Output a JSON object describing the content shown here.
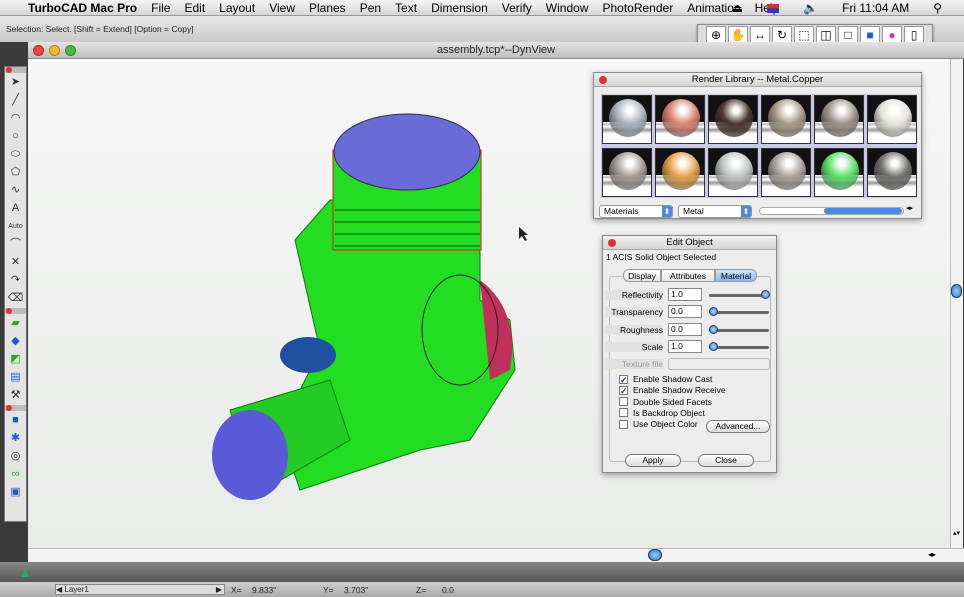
{
  "menubar": {
    "app": "TurboCAD Mac Pro",
    "items": [
      "File",
      "Edit",
      "Layout",
      "View",
      "Planes",
      "Pen",
      "Text",
      "Dimension",
      "Verify",
      "Window",
      "PhotoRender",
      "Animation",
      "Help"
    ],
    "clock": "Fri 11:04 AM"
  },
  "status_text": "Selection: Select. [Shift = Extend] [Option = Copy]",
  "view_toolbar": {
    "icons": [
      "zoom-icon",
      "pan-hand-icon",
      "move-arrows-icon",
      "orbit-icon",
      "wireframe-cube-icon",
      "hidden-line-cube-icon",
      "outline-cube-icon",
      "shaded-cube-icon",
      "render-sphere-icon",
      "box-icon"
    ]
  },
  "window": {
    "title": "assembly.tcp*--DynView"
  },
  "render_library": {
    "title": "Render Library -- Metal.Copper",
    "category": "Materials",
    "subcategory": "Metal",
    "swatch_colors": [
      "#a9b4bc",
      "#d98670",
      "#4a3631",
      "#a89a88",
      "#9c948a",
      "#e6e4dc",
      "#a39c92",
      "#e6a24a",
      "#c2c4c4",
      "#aca29a",
      "#5fe06a",
      "#75736e"
    ]
  },
  "edit_object": {
    "title": "Edit Object",
    "selection": "1 ACIS Solid Object Selected",
    "tabs": [
      "Display",
      "Attributes",
      "Material"
    ],
    "active_tab": "Material",
    "props": [
      {
        "label": "Reflectivity",
        "value": "1.0",
        "slider": 1.0
      },
      {
        "label": "Transparency",
        "value": "0.0",
        "slider": 0.0
      },
      {
        "label": "Roughness",
        "value": "0.0",
        "slider": 0.0
      },
      {
        "label": "Scale",
        "value": "1.0",
        "slider": 0.0
      }
    ],
    "texture_label": "Texture file",
    "checks": [
      {
        "label": "Enable Shadow Cast",
        "checked": true
      },
      {
        "label": "Enable Shadow Receive",
        "checked": true
      },
      {
        "label": "Double Sided Facets",
        "checked": false
      },
      {
        "label": "Is Backdrop Object",
        "checked": false
      },
      {
        "label": "Use Object Color",
        "checked": false
      }
    ],
    "advanced": "Advanced...",
    "apply": "Apply",
    "close": "Close"
  },
  "statusbar": {
    "layer": "Layer1",
    "x_label": "X=",
    "x": "9.833\"",
    "y_label": "Y=",
    "y": "3.703\"",
    "z_label": "Z=",
    "z": "0.0"
  }
}
